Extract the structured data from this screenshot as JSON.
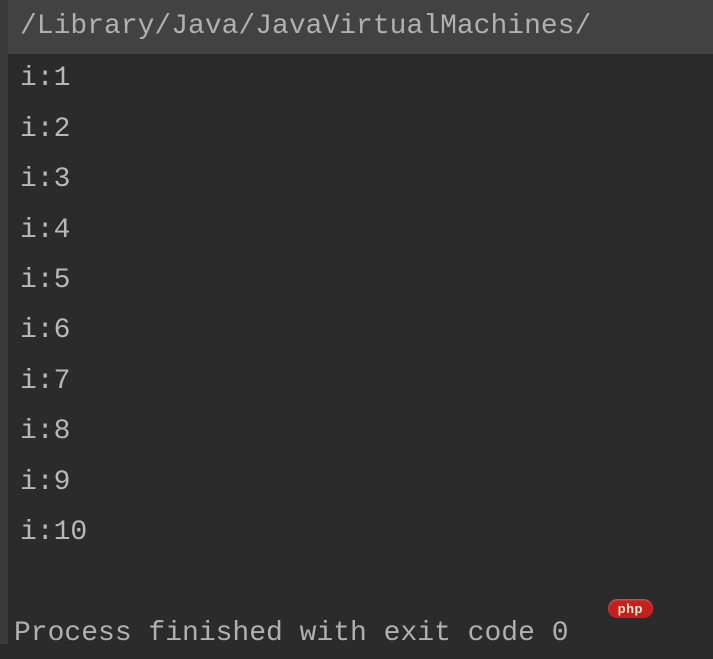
{
  "console": {
    "path": "/Library/Java/JavaVirtualMachines/",
    "output": [
      "i:1",
      "i:2",
      "i:3",
      "i:4",
      "i:5",
      "i:6",
      "i:7",
      "i:8",
      "i:9",
      "i:10"
    ],
    "status": "Process finished with exit code 0"
  },
  "watermark": {
    "text": "php"
  }
}
